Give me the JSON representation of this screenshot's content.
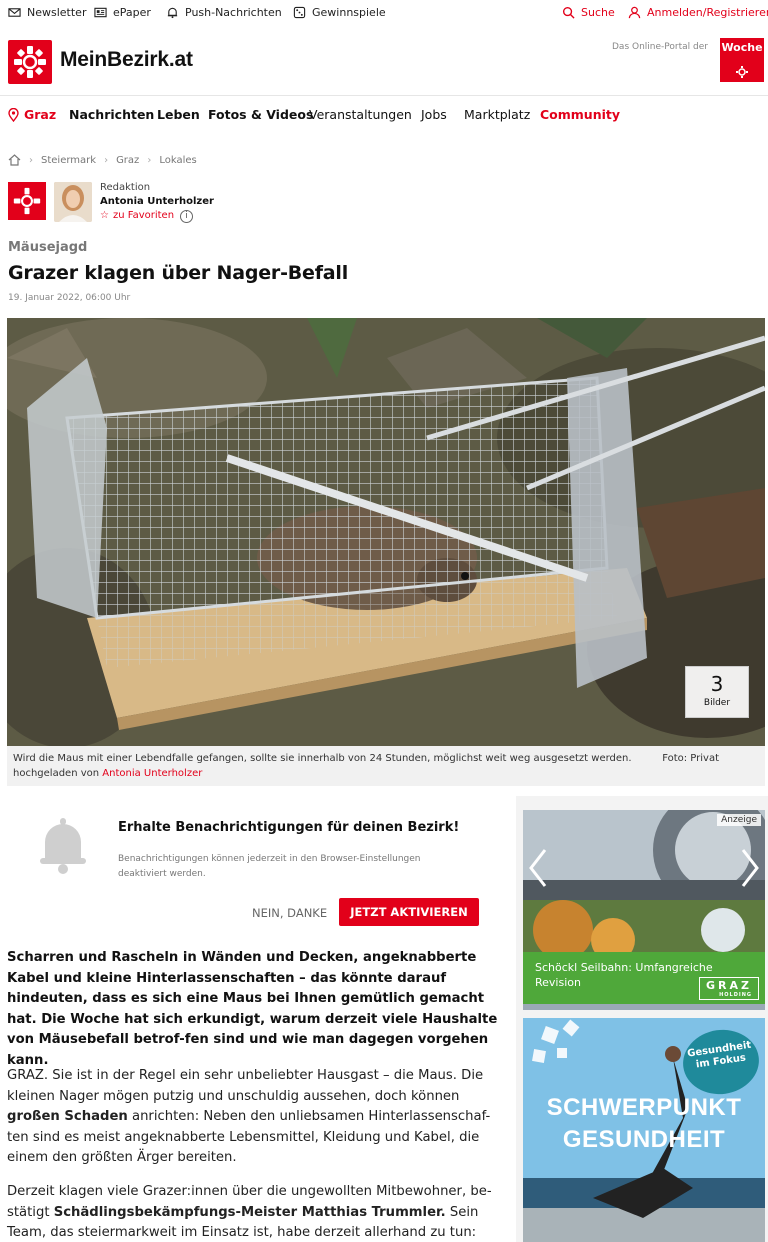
{
  "util": {
    "newsletter": "Newsletter",
    "epaper": "ePaper",
    "push": "Push-Nachrichten",
    "gewinnspiele": "Gewinnspiele",
    "suche": "Suche",
    "login": "Anmelden/Registrieren"
  },
  "header": {
    "site_name": "MeinBezirk.at",
    "portal_text": "Das Online-Portal der",
    "woche_label": "Woche"
  },
  "nav": {
    "location": "Graz",
    "items": [
      "Nachrichten",
      "Leben",
      "Fotos & Videos",
      "Veranstaltungen",
      "Jobs",
      "Marktplatz",
      "Community"
    ]
  },
  "breadcrumb": [
    "Steiermark",
    "Graz",
    "Lokales"
  ],
  "author": {
    "role": "Redaktion",
    "name": "Antonia Unterholzer",
    "favorite": "zu Favoriten"
  },
  "article": {
    "kicker": "Mäusejagd",
    "title": "Grazer klagen über Nager-Befall",
    "date": "19. Januar 2022, 06:00 Uhr",
    "image_count": "3",
    "image_count_label": "Bilder",
    "caption": "Wird die Maus mit einer Lebendfalle gefangen, sollte sie innerhalb von 24 Stunden, möglichst weit weg ausgesetzt werden.",
    "photo_credit": "Foto: Privat",
    "uploaded_by_label": "hochgeladen von",
    "uploaded_by": "Antonia Unterholzer",
    "lead": "Scharren und Rascheln in Wänden und Decken, angeknabberte Kabel und kleine Hinterlassenschaften – das könnte darauf hindeuten, dass es sich eine Maus bei Ihnen gemütlich gemacht hat. Die Woche hat sich erkundigt, warum derzeit viele Haushalte von Mäusebefall betrof-fen sind und wie man dagegen vorgehen kann.",
    "p1_a": "GRAZ. Sie ist in der Regel ein sehr unbeliebter Hausgast – die Maus. Die kleinen Nager mögen putzig und unschuldig aussehen, doch können ",
    "p1_b": "großen Schaden",
    "p1_c": " anrichten: Neben den unliebsamen Hinterlassenschaf-ten sind es meist angeknabberte Lebensmittel, Kleidung und Kabel, die einem den größten Ärger bereiten.",
    "p2_a": "Derzeit klagen viele Grazer:innen über die ungewollten Mitbewohner, be-stätigt ",
    "p2_b": "Schädlingsbekämpfungs-Meister Matthias Trummler.",
    "p2_c": " Sein Team, das steiermarkweit im Einsatz ist, habe derzeit allerhand zu tun:"
  },
  "push_box": {
    "title": "Erhalte Benachrichtigungen für deinen Bezirk!",
    "subtitle": "Benachrichtigungen können jederzeit in den Browser-Einstellungen deaktiviert werden.",
    "decline": "NEIN, DANKE",
    "accept": "JETZT AKTIVIEREN"
  },
  "sidebar": {
    "ad_label": "Anzeige",
    "ad1_text": "Schöckl Seilbahn: Umfangreiche Revision",
    "ad1_brand": "GRAZ",
    "ad1_brand_sub": "HOLDING",
    "ad2_badge": "Gesundheit im Fokus",
    "ad2_line1": "SCHWERPUNKT",
    "ad2_line2": "GESUNDHEIT"
  },
  "colors": {
    "brand_red": "#e2001a",
    "ad_green": "#4fa83a"
  }
}
